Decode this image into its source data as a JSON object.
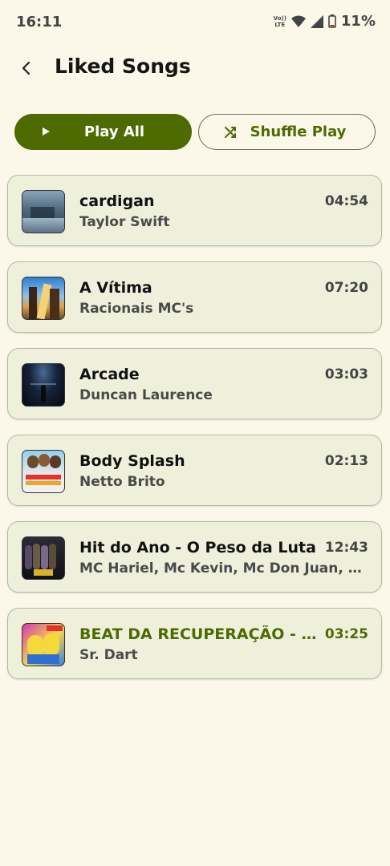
{
  "status_bar": {
    "time": "16:11",
    "volte_top": "Vo))",
    "volte_bottom": "LTE",
    "battery": "11%"
  },
  "header": {
    "back_icon": "chevron-left-icon",
    "title": "Liked Songs"
  },
  "actions": {
    "play_all_label": "Play All",
    "play_icon": "play-icon",
    "shuffle_label": "Shuffle Play",
    "shuffle_icon": "shuffle-icon"
  },
  "colors": {
    "accent": "#4d6b00",
    "background": "#fbf8ea",
    "card": "#eff0dc"
  },
  "songs": [
    {
      "title": "cardigan",
      "artist": "Taylor Swift",
      "duration": "04:54",
      "playing": false
    },
    {
      "title": "A Vítima",
      "artist": "Racionais MC's",
      "duration": "07:20",
      "playing": false
    },
    {
      "title": "Arcade",
      "artist": "Duncan Laurence",
      "duration": "03:03",
      "playing": false
    },
    {
      "title": "Body Splash",
      "artist": "Netto Brito",
      "duration": "02:13",
      "playing": false
    },
    {
      "title": "Hit do Ano - O Peso da Luta",
      "artist": "MC Hariel, Mc Kevin, Mc Don Juan, Mc Davi",
      "duration": "12:43",
      "playing": false
    },
    {
      "title": "BEAT DA RECUPERAÇÃO - R...",
      "artist": "Sr. Dart",
      "duration": "03:25",
      "playing": true
    }
  ]
}
